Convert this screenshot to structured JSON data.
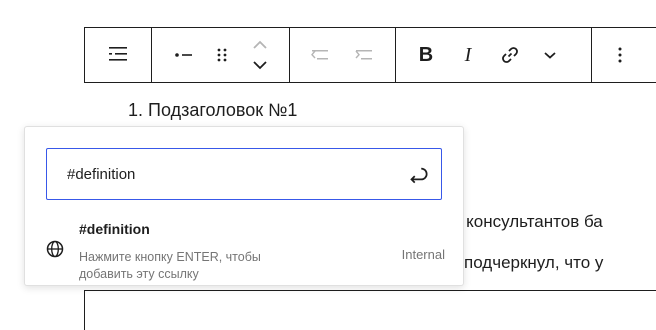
{
  "list": {
    "item_number": "1.",
    "item_text": "Подзаголовок №1"
  },
  "body_lines": [
    "к консультантов ба",
    "подчеркнул, что у"
  ],
  "toolbar": {
    "buttons": [
      {
        "name": "block-type-list",
        "icon": "list-icon"
      },
      {
        "name": "list-style",
        "icon": "bullet-dash-icon"
      },
      {
        "name": "drag-handle",
        "icon": "drag-handle-icon"
      },
      {
        "name": "move-up-down",
        "icon": "chevron-up-down-icon"
      },
      {
        "name": "outdent",
        "icon": "outdent-icon",
        "disabled": true
      },
      {
        "name": "indent",
        "icon": "indent-icon",
        "disabled": true
      },
      {
        "name": "bold",
        "label": "B"
      },
      {
        "name": "italic",
        "label": "I"
      },
      {
        "name": "link",
        "icon": "link-icon"
      },
      {
        "name": "more-rich-text",
        "icon": "chevron-down-icon"
      },
      {
        "name": "options",
        "icon": "vertical-ellipsis-icon"
      }
    ],
    "bold_label": "B",
    "italic_label": "I"
  },
  "link_popover": {
    "input_value": "#definition",
    "suggestion": {
      "title": "#definition",
      "description": "Нажмите кнопку ENTER, чтобы добавить эту ссылку",
      "type": "Internal"
    }
  },
  "colors": {
    "accent": "#3858e9",
    "text": "#1e1e1e",
    "muted": "#757575",
    "disabled": "#b5b5b5"
  }
}
